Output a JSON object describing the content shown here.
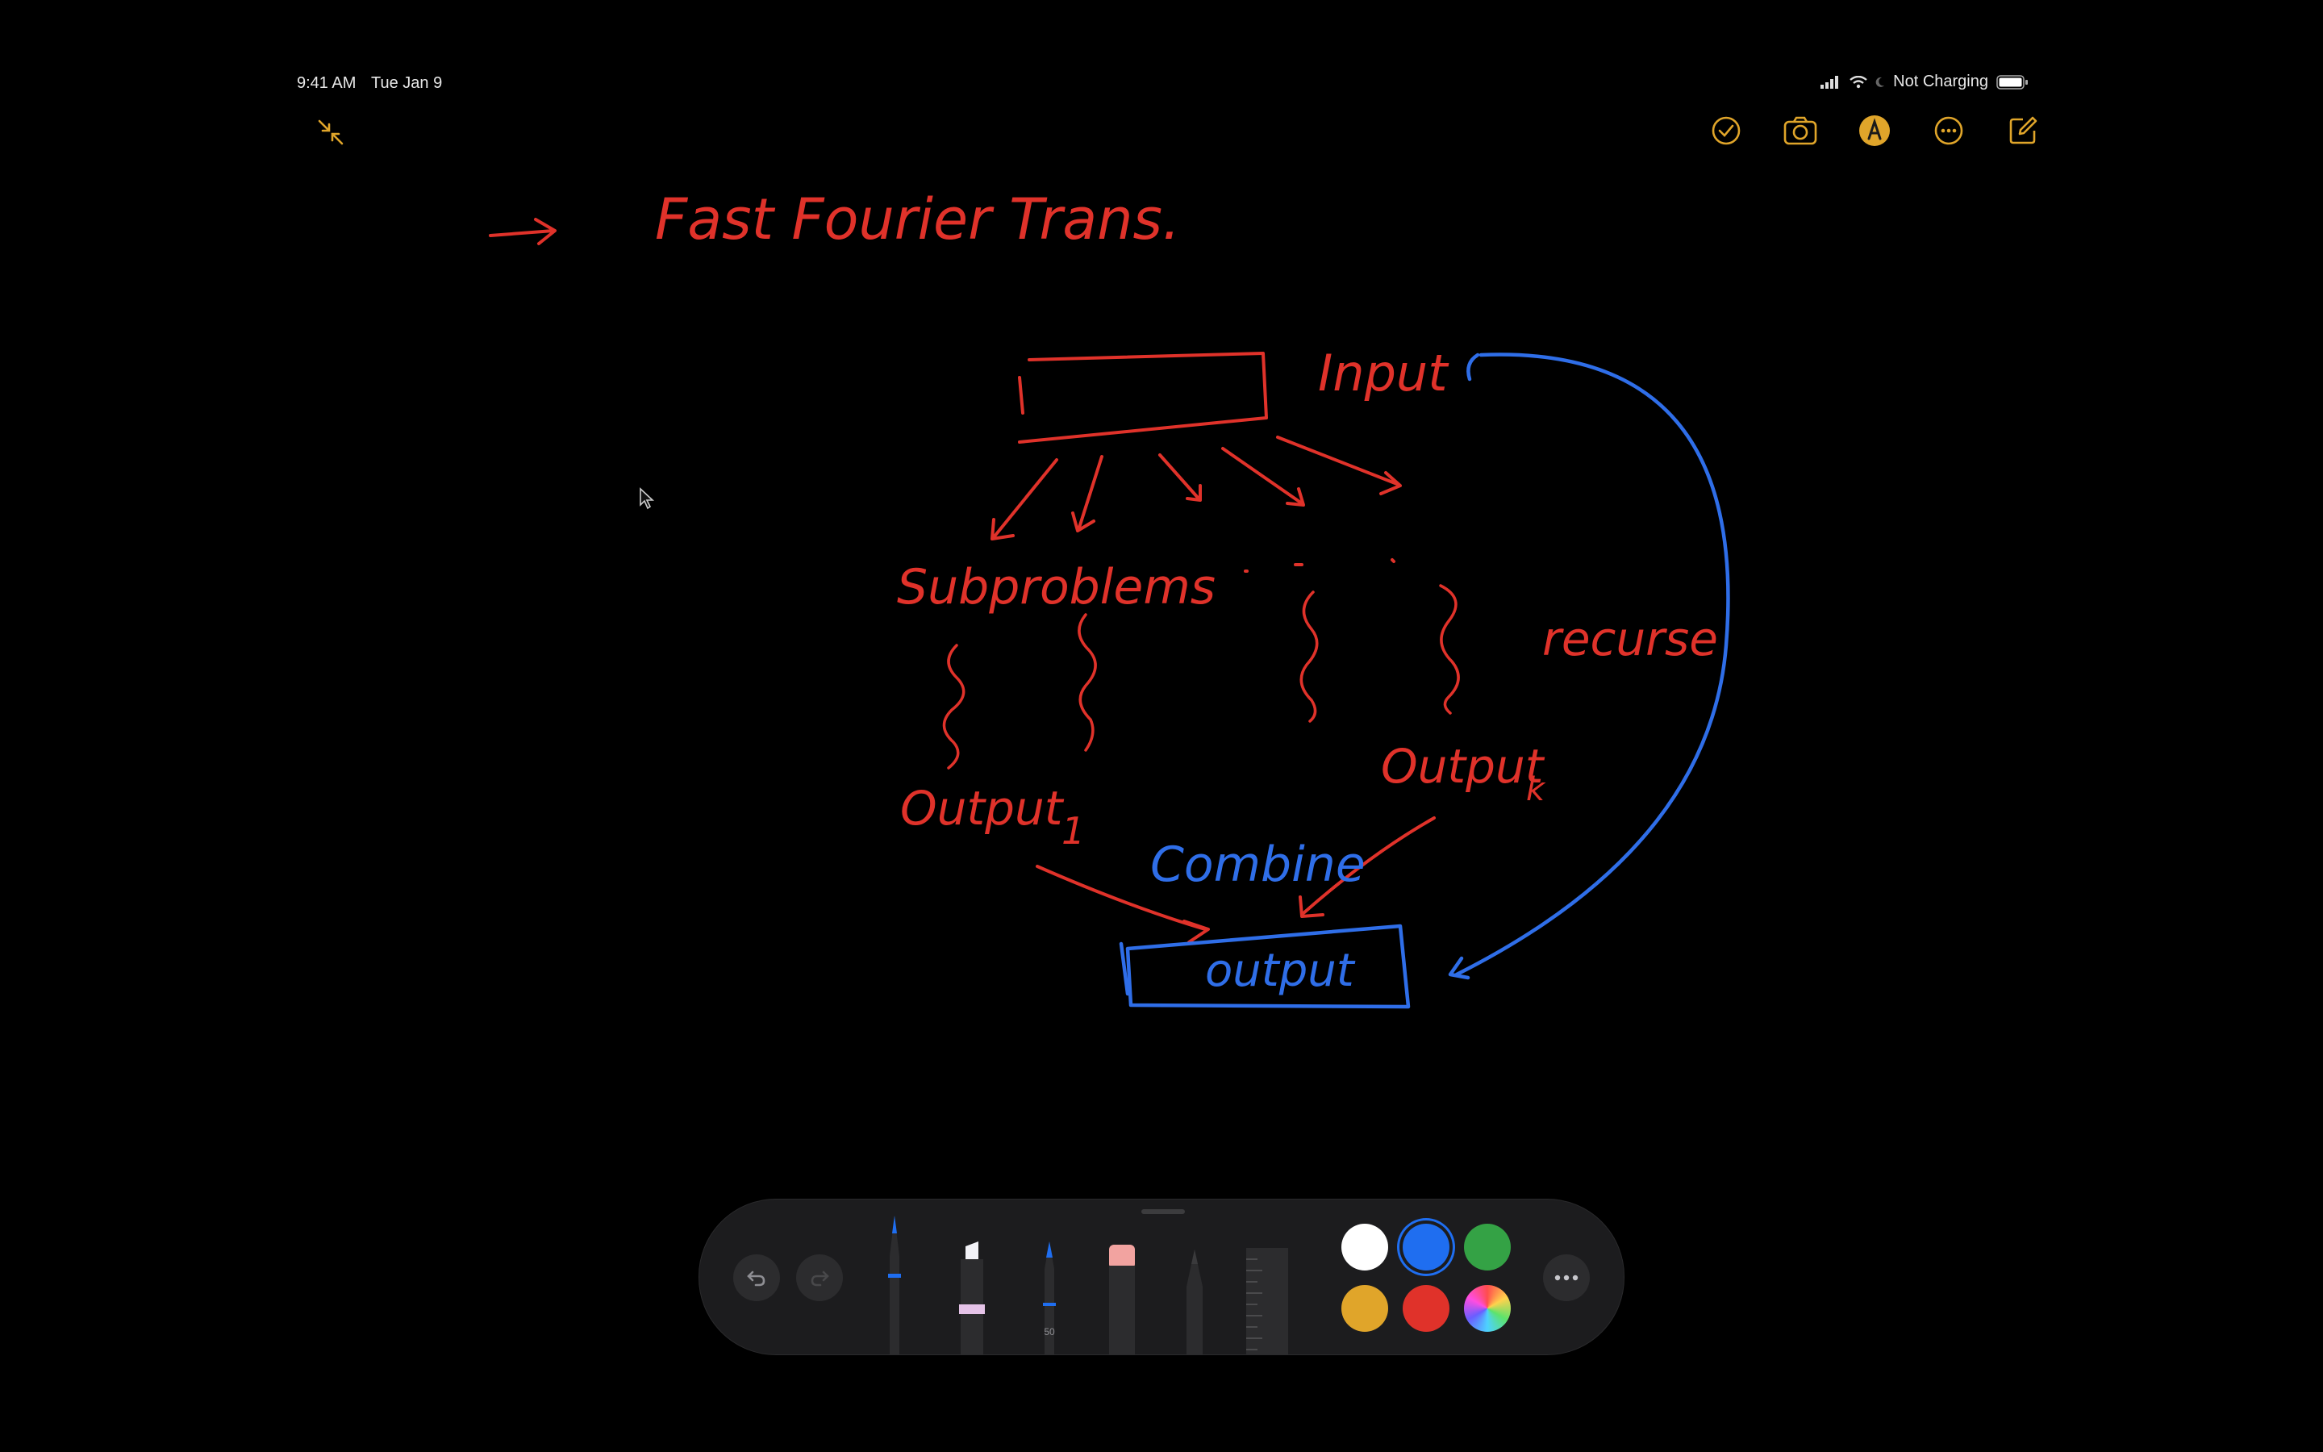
{
  "status_bar": {
    "time": "9:41 AM",
    "date": "Tue Jan 9",
    "battery_status": "Not Charging",
    "icons": [
      "cellular-icon",
      "wifi-icon",
      "moon-icon",
      "battery-icon"
    ]
  },
  "top_toolbar": {
    "left_icon": "collapse-arrows-icon",
    "right_icons": [
      "checklist-icon",
      "camera-icon",
      "markup-icon",
      "more-icon",
      "compose-icon"
    ]
  },
  "note_ink": {
    "title": "Fast Fourier Trans.",
    "labels": {
      "input": "Input",
      "subproblems": "Subproblems",
      "recurse": "recurse",
      "output_1": "Output",
      "output_1_sub": "1",
      "output_k": "Output",
      "output_k_sub": "k",
      "combine": "Combine",
      "final_output": "output"
    },
    "ink_colors": {
      "red": "#e0322a",
      "blue": "#2f6ee8"
    }
  },
  "tool_palette": {
    "undo_icon": "undo-icon",
    "redo_icon": "redo-icon",
    "tools": [
      "pen-tool",
      "highlighter-tool",
      "fineliner-tool",
      "eraser-tool",
      "pencil-tool",
      "ruler-tool"
    ],
    "fineliner_width": "50",
    "colors": [
      {
        "name": "white",
        "hex": "#ffffff"
      },
      {
        "name": "blue",
        "hex": "#1f6ef0",
        "selected": true
      },
      {
        "name": "green",
        "hex": "#34a245"
      },
      {
        "name": "yellow",
        "hex": "#e0a52a"
      },
      {
        "name": "red",
        "hex": "#e0322a"
      },
      {
        "name": "multicolor",
        "hex": "spectrum"
      }
    ],
    "more_icon": "more-icon"
  }
}
